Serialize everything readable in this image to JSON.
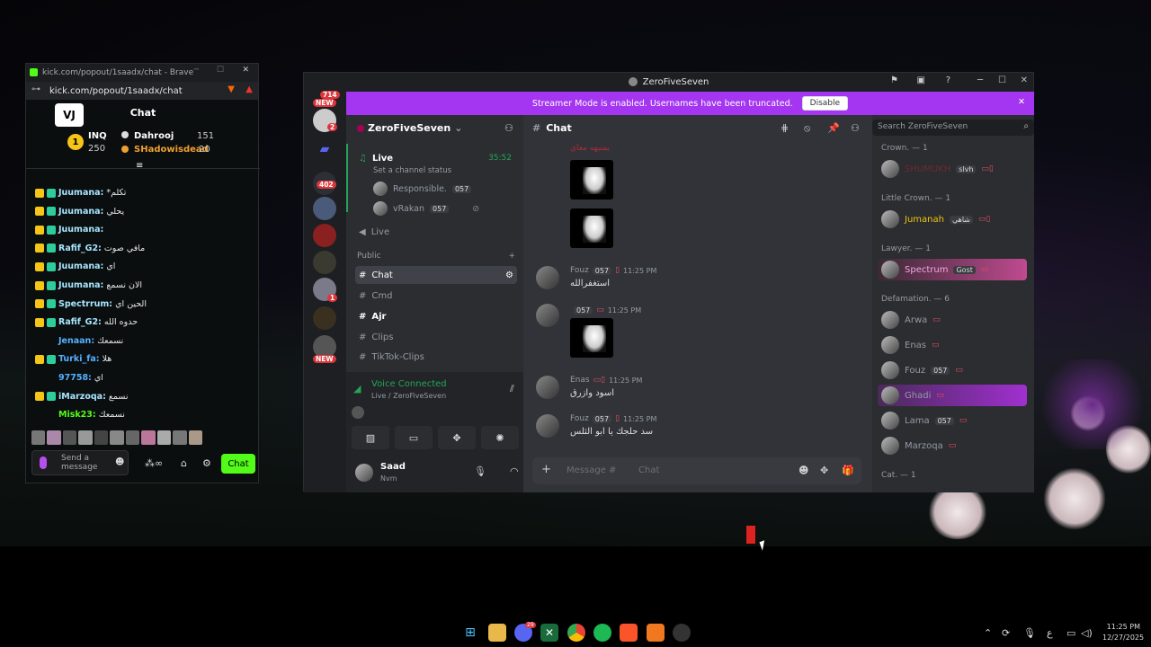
{
  "kick": {
    "window_title": "kick.com/popout/1saadx/chat - Brave",
    "url": "kick.com/popout/1saadx/chat",
    "header": "Chat",
    "leaderboard": [
      {
        "rank": "1",
        "name": "INQ",
        "value": "250"
      },
      {
        "name": "Dahrooj",
        "value": "151"
      },
      {
        "name": "SHadowisdead",
        "value": "20"
      }
    ],
    "messages": [
      {
        "user": "Juumana:",
        "text": "*تكلم",
        "color": "#a8e6ff"
      },
      {
        "user": "Juumana:",
        "text": "يحلي",
        "color": "#a8e6ff"
      },
      {
        "user": "Juumana:",
        "text": "",
        "color": "#a8e6ff"
      },
      {
        "user": "Rafif_G2:",
        "text": "مافي صوت",
        "color": "#a8e6ff"
      },
      {
        "user": "Juumana:",
        "text": "اي",
        "color": "#a8e6ff"
      },
      {
        "user": "Juumana:",
        "text": "الان نسمع",
        "color": "#a8e6ff"
      },
      {
        "user": "Spectrrum:",
        "text": "الحين اي",
        "color": "#a8e6ff"
      },
      {
        "user": "Rafif_G2:",
        "text": "حدوه الله",
        "color": "#a8e6ff"
      },
      {
        "user": "Jenaan:",
        "text": "نسمعك",
        "color": "#54b0ff"
      },
      {
        "user": "Turki_fa:",
        "text": "هلا",
        "color": "#54b0ff"
      },
      {
        "user": "97758:",
        "text": "اي",
        "color": "#54b0ff"
      },
      {
        "user": "iMarzoqa:",
        "text": "نسمع",
        "color": "#a8e6ff"
      },
      {
        "user": "Misk23:",
        "text": "نسمعك",
        "color": "#53fc18"
      }
    ],
    "input_placeholder": "Send a message",
    "chat_button": "Chat"
  },
  "discord": {
    "window_title": "ZeroFiveSeven",
    "banner_text": "Streamer Mode is enabled. Usernames have been truncated.",
    "banner_button": "Disable",
    "server_name": "ZeroFiveSeven",
    "guild_badges": {
      "top": "714",
      "mid": "402",
      "new1": "NEW",
      "new2": "NEW",
      "two": "2",
      "one": "1"
    },
    "voice": {
      "channel": "Live",
      "status": "Set a channel status",
      "time": "35:52",
      "users": [
        {
          "name": "Responsible.",
          "tag": "057"
        },
        {
          "name": "vRakan",
          "tag": "057"
        }
      ]
    },
    "channels": {
      "live2": "Live",
      "category": "Public",
      "chat": "Chat",
      "cmd": "Cmd",
      "ajr": "Ajr",
      "clips": "Clips",
      "tiktok": "TikTok-Clips"
    },
    "voice_connected": {
      "title": "Voice Connected",
      "sub": "Live / ZeroFiveSeven"
    },
    "user": {
      "name": "Saad",
      "status": "Nvm"
    },
    "chat_header": "Chat",
    "search_placeholder": "Search ZeroFiveSeven",
    "messages": [
      {
        "author": "Fouz",
        "tag": "057",
        "time": "11:25 PM",
        "text": "استغفرالله"
      },
      {
        "author": "",
        "tag": "057",
        "time": "11:25 PM",
        "text": ""
      },
      {
        "author": "Enas",
        "tag": "",
        "time": "11:25 PM",
        "text": "اسود وازرق"
      },
      {
        "author": "Fouz",
        "tag": "057",
        "time": "11:25 PM",
        "text": "سد حلجك يا ابو الثلس"
      }
    ],
    "top_snippet": "يمتيهه معاي",
    "message_placeholder": "Message #",
    "message_placeholder_channel": "Chat",
    "members": {
      "crown": "Crown. — 1",
      "crown_user": {
        "name": "SHUMUKH",
        "tag": "slvh"
      },
      "little_crown": "Little Crown. — 1",
      "little_user": {
        "name": "Jumanah",
        "tag": "شاهي"
      },
      "lawyer": "Lawyer. — 1",
      "lawyer_user": {
        "name": "Spectrum",
        "tag": "Gost"
      },
      "defamation": "Defamation. — 6",
      "def_users": [
        {
          "name": "Arwa",
          "tag": ""
        },
        {
          "name": "Enas",
          "tag": ""
        },
        {
          "name": "Fouz",
          "tag": "057"
        },
        {
          "name": "Ghadi",
          "tag": ""
        },
        {
          "name": "Lama",
          "tag": "057"
        },
        {
          "name": "Marzoqa",
          "tag": ""
        }
      ],
      "cat": "Cat. — 1"
    }
  },
  "taskbar": {
    "time": "11:25 PM",
    "date": "12/27/2025",
    "lang": "ع",
    "discord_badge": "29"
  }
}
